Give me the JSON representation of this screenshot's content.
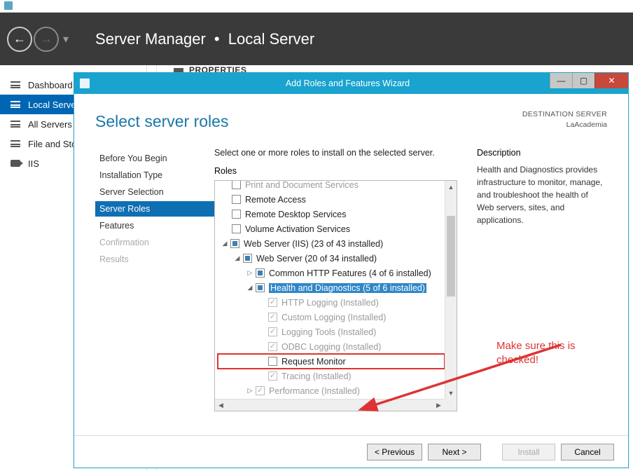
{
  "header": {
    "app": "Server Manager",
    "section": "Local Server"
  },
  "nav": {
    "items": [
      {
        "label": "Dashboard"
      },
      {
        "label": "Local Server"
      },
      {
        "label": "All Servers"
      },
      {
        "label": "File and Storage Services"
      },
      {
        "label": "IIS"
      }
    ]
  },
  "bg": {
    "properties": "PROPERTIES"
  },
  "modal": {
    "title": "Add Roles and Features Wizard",
    "page_title": "Select server roles",
    "dest_label": "DESTINATION SERVER",
    "dest_name": "LaAcademia",
    "steps": [
      "Before You Begin",
      "Installation Type",
      "Server Selection",
      "Server Roles",
      "Features",
      "Confirmation",
      "Results"
    ],
    "intro": "Select one or more roles to install on the selected server.",
    "roles_label": "Roles",
    "nodes": {
      "print": "Print and Document Services",
      "remote_access": "Remote Access",
      "remote_desktop": "Remote Desktop Services",
      "volume_activation": "Volume Activation Services",
      "web_iis": "Web Server (IIS) (23 of 43 installed)",
      "web_server": "Web Server (20 of 34 installed)",
      "common_http": "Common HTTP Features (4 of 6 installed)",
      "health_diag": "Health and Diagnostics (5 of 6 installed)",
      "http_logging": "HTTP Logging (Installed)",
      "custom_logging": "Custom Logging (Installed)",
      "logging_tools": "Logging Tools (Installed)",
      "odbc_logging": "ODBC Logging (Installed)",
      "request_monitor": "Request Monitor",
      "tracing": "Tracing (Installed)",
      "performance": "Performance (Installed)"
    },
    "desc_label": "Description",
    "desc_text": "Health and Diagnostics provides infrastructure to monitor, manage, and troubleshoot the health of Web servers, sites, and applications.",
    "buttons": {
      "previous": "< Previous",
      "next": "Next >",
      "install": "Install",
      "cancel": "Cancel"
    }
  },
  "annotation": {
    "text": "Make sure this is checked!"
  }
}
